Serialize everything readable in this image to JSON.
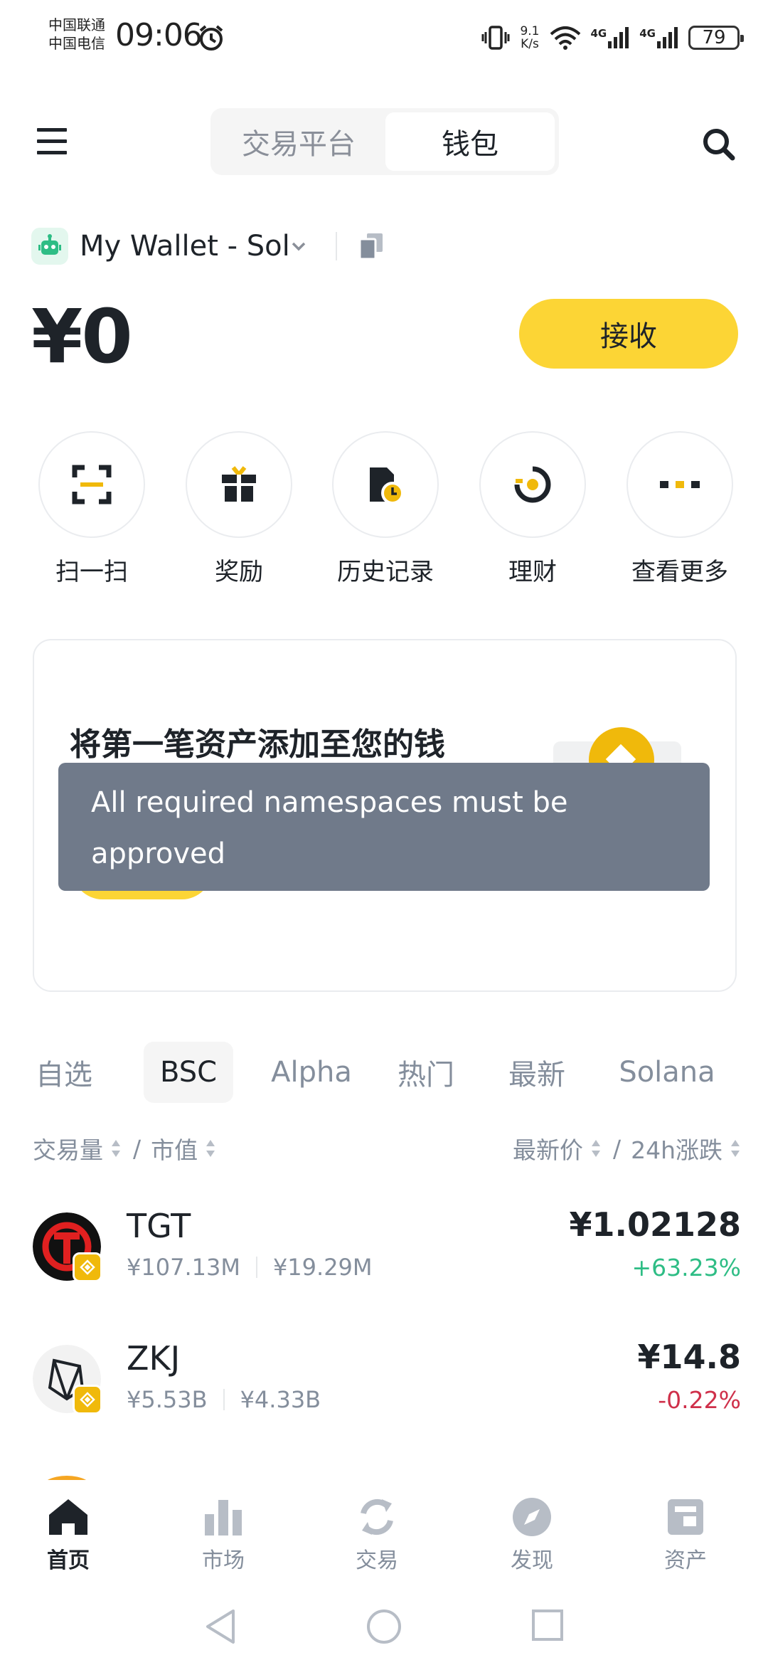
{
  "status_bar": {
    "carrier_1": "中国联通",
    "carrier_2": "中国电信",
    "time": "09:06",
    "net_speed_value": "9.1",
    "net_speed_unit": "K/s",
    "signal_1": "4G",
    "signal_2": "4G",
    "battery": "79"
  },
  "header": {
    "segment_exchange": "交易平台",
    "segment_wallet": "钱包",
    "active_segment": "钱包"
  },
  "wallet": {
    "name": "My Wallet - Sol",
    "balance": "¥0",
    "receive_label": "接收"
  },
  "quick_actions": [
    {
      "label": "扫一扫",
      "icon": "scan-icon"
    },
    {
      "label": "奖励",
      "icon": "gift-icon"
    },
    {
      "label": "历史记录",
      "icon": "history-icon"
    },
    {
      "label": "理财",
      "icon": "earn-icon"
    },
    {
      "label": "查看更多",
      "icon": "more-icon"
    }
  ],
  "promo": {
    "title": "将第一笔资产添加至您的钱"
  },
  "toast": {
    "message": "All required namespaces must be approved"
  },
  "market_tabs": [
    {
      "label": "自选"
    },
    {
      "label": "BSC"
    },
    {
      "label": "Alpha"
    },
    {
      "label": "热门"
    },
    {
      "label": "最新"
    },
    {
      "label": "Solana"
    }
  ],
  "active_tab": "BSC",
  "sort": {
    "volume": "交易量",
    "separator": "/",
    "market_cap": "市值",
    "last_price": "最新价",
    "change_24h": "24h涨跌"
  },
  "coins": [
    {
      "symbol": "TGT",
      "volume": "¥107.13M",
      "market_cap": "¥19.29M",
      "price": "¥1.02128",
      "change": "+63.23%"
    },
    {
      "symbol": "ZKJ",
      "volume": "¥5.53B",
      "market_cap": "¥4.33B",
      "price": "¥14.8",
      "change": "-0.22%"
    }
  ],
  "bottom_nav": [
    {
      "label": "首页",
      "icon": "home-icon"
    },
    {
      "label": "市场",
      "icon": "market-icon"
    },
    {
      "label": "交易",
      "icon": "trade-icon"
    },
    {
      "label": "发现",
      "icon": "discover-icon"
    },
    {
      "label": "资产",
      "icon": "assets-icon"
    }
  ],
  "active_nav": "首页",
  "colors": {
    "brand_yellow": "#fcd535",
    "up_green": "#2ebd85",
    "down_red": "#cf304a",
    "toast_bg": "#707a8a"
  }
}
